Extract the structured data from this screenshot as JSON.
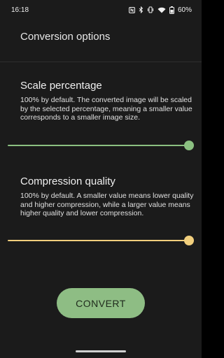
{
  "status_bar": {
    "time": "16:18",
    "battery": "60%",
    "icons": [
      "nfc-icon",
      "bluetooth-icon",
      "vibrate-icon",
      "wifi-icon",
      "battery-icon"
    ]
  },
  "header": {
    "title": "Conversion options"
  },
  "scale": {
    "title": "Scale percentage",
    "description": "100% by default. The converted image will be scaled by the selected percentage, meaning a smaller value corresponds to a smaller image size.",
    "value_percent": 100,
    "color": "#8bc081"
  },
  "compression": {
    "title": "Compression quality",
    "description": "100% by default. A smaller value means lower quality and higher compression, while a larger value means higher quality and lower compression.",
    "value_percent": 100,
    "color": "#f1cf7d"
  },
  "convert_button": {
    "label": "CONVERT",
    "color": "#8ebd84"
  },
  "colors": {
    "background": "#1b1b1b"
  }
}
